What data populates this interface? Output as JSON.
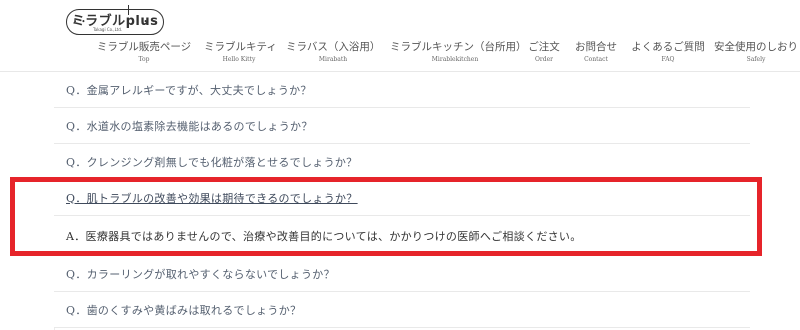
{
  "logo": {
    "name": "ミラブルplus",
    "tagline": "Takagi Co.,Ltd.",
    "dots": "• •"
  },
  "nav": {
    "items": [
      {
        "jp": "ミラブル販売ページ",
        "en": "Top"
      },
      {
        "jp": "ミラブルキティ",
        "en": "Hello Kitty"
      },
      {
        "jp": "ミラバス（入浴用）",
        "en": "Mirabath"
      },
      {
        "jp": "ミラブルキッチン（台所用）",
        "en": "Mirablekitchen"
      },
      {
        "jp": "ご注文",
        "en": "Order"
      },
      {
        "jp": "お問合せ",
        "en": "Contact"
      },
      {
        "jp": "よくあるご質問",
        "en": "FAQ"
      },
      {
        "jp": "安全使用のしおり",
        "en": "Safely"
      }
    ]
  },
  "faq": {
    "rows": [
      {
        "type": "q",
        "text": "Q．金属アレルギーですが、大丈夫でしょうか？"
      },
      {
        "type": "q",
        "text": "Q．水道水の塩素除去機能はあるのでしょうか？"
      },
      {
        "type": "q",
        "text": "Q．クレンジング剤無しでも化粧が落とせるでしょうか？"
      },
      {
        "type": "q-active",
        "text": "Q．肌トラブルの改善や効果は期待できるのでしょうか？"
      },
      {
        "type": "a",
        "text": "A．医療器具ではありませんので、治療や改善目的については、かかりつけの医師へご相談ください。"
      },
      {
        "type": "q",
        "text": "Q．カラーリングが取れやすくならないでしょうか？"
      },
      {
        "type": "q",
        "text": "Q．歯のくすみや黄ばみは取れるでしょうか？"
      }
    ]
  },
  "colors": {
    "highlight": "#e6242a",
    "text": "#556070"
  }
}
